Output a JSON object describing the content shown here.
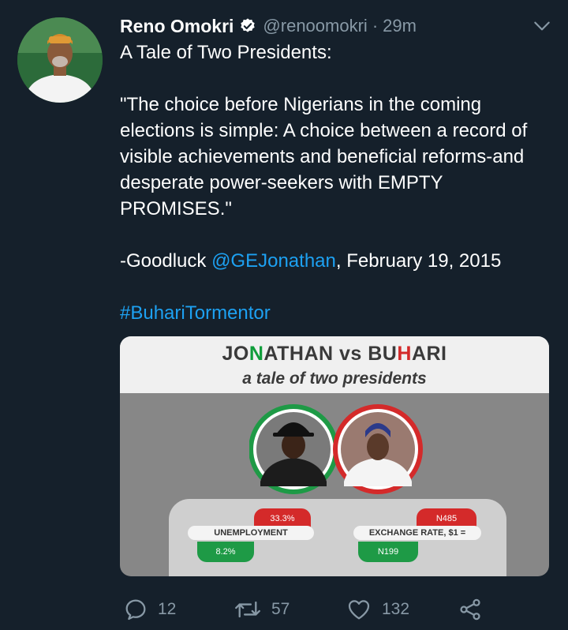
{
  "tweet": {
    "author_name": "Reno Omokri",
    "handle": "@renoomokri",
    "separator": "·",
    "time": "29m",
    "text": {
      "line1": "A Tale of Two Presidents:",
      "quote": "\"The choice before Nigerians in the coming elections is simple: A choice between a record of visible achievements and beneficial reforms-and desperate power-seekers with EMPTY PROMISES.\"",
      "attribution_prefix": "-Goodluck ",
      "mention": "@GEJonathan",
      "attribution_suffix": ", February 19, 2015",
      "hashtag": "#BuhariTormentor"
    }
  },
  "media": {
    "title_part1": "JO",
    "title_part2": "N",
    "title_part3": "ATHAN vs BU",
    "title_part4": "H",
    "title_part5": "ARI",
    "subtitle": "a tale of two presidents",
    "stats": {
      "unemployment_label": "UNEMPLOYMENT",
      "unemployment_high": "33.3%",
      "unemployment_low": "8.2%",
      "exchange_label": "EXCHANGE RATE, $1 =",
      "exchange_high": "N485",
      "exchange_low": "N199"
    }
  },
  "actions": {
    "reply_count": "12",
    "retweet_count": "57",
    "like_count": "132"
  },
  "colors": {
    "background": "#15202b",
    "secondary_text": "#8899a6",
    "link": "#1da1f2"
  }
}
